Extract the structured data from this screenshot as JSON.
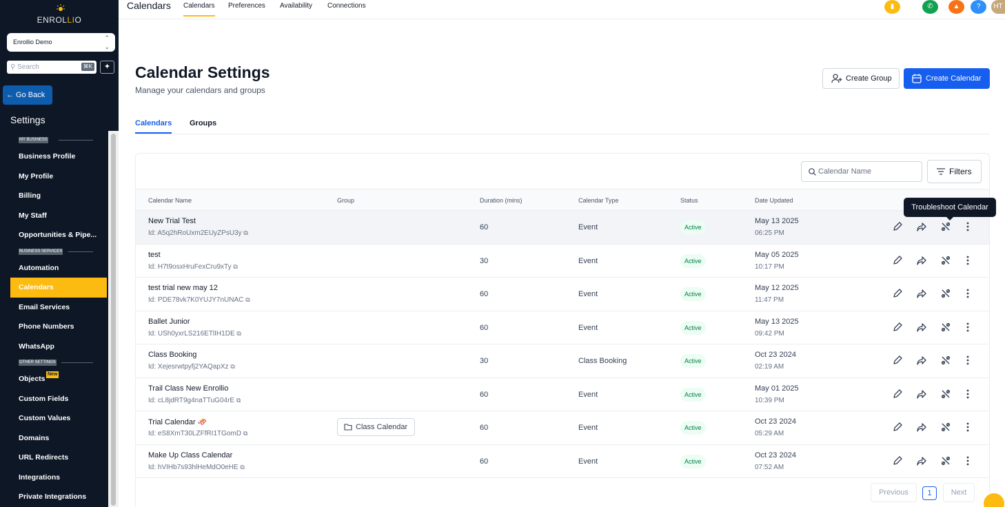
{
  "logo": {
    "text_a": "ENROL",
    "text_b": "LI",
    "text_c": "O"
  },
  "account": {
    "name": "Enrollio Demo"
  },
  "search": {
    "placeholder": "Search",
    "shortcut": "⌘K"
  },
  "sidebar": {
    "go_back": "← Go Back",
    "title": "Settings",
    "sections": [
      {
        "label": "MY BUSINESS",
        "items": [
          {
            "label": "Business Profile"
          },
          {
            "label": "My Profile"
          },
          {
            "label": "Billing"
          },
          {
            "label": "My Staff"
          },
          {
            "label": "Opportunities & Pipe..."
          }
        ]
      },
      {
        "label": "BUSINESS SERVICES",
        "items": [
          {
            "label": "Automation"
          },
          {
            "label": "Calendars",
            "active": true
          },
          {
            "label": "Email Services"
          },
          {
            "label": "Phone Numbers"
          },
          {
            "label": "WhatsApp"
          }
        ]
      },
      {
        "label": "OTHER SETTINGS",
        "items": [
          {
            "label": "Objects",
            "badge": "New"
          },
          {
            "label": "Custom Fields"
          },
          {
            "label": "Custom Values"
          },
          {
            "label": "Domains"
          },
          {
            "label": "URL Redirects"
          },
          {
            "label": "Integrations"
          },
          {
            "label": "Private Integrations"
          }
        ]
      }
    ]
  },
  "topbar": {
    "brand": "Calendars",
    "nav": [
      "Calendars",
      "Preferences",
      "Availability",
      "Connections"
    ],
    "avatar": "HT"
  },
  "page": {
    "title": "Calendar Settings",
    "subtitle": "Manage your calendars and groups",
    "create_group": "Create Group",
    "create_calendar": "Create Calendar",
    "tabs": [
      "Calendars",
      "Groups"
    ]
  },
  "table": {
    "search_placeholder": "Calendar Name",
    "filters_label": "Filters",
    "columns": [
      "Calendar Name",
      "Group",
      "Duration (mins)",
      "Calendar Type",
      "Status",
      "Date Updated"
    ],
    "rows": [
      {
        "name": "New Trial Test",
        "id": "Id: A5q2hRoUxm2EUyZPsU3y",
        "group": "",
        "duration": "60",
        "type": "Event",
        "status": "Active",
        "date": "May 13 2025",
        "time": "06:25 PM"
      },
      {
        "name": "test",
        "id": "Id: H7t9osxHruFexCru9xTy",
        "group": "",
        "duration": "30",
        "type": "Event",
        "status": "Active",
        "date": "May 05 2025",
        "time": "10:17 PM"
      },
      {
        "name": "test trial new may 12",
        "id": "Id: PDE78vk7K0YUJY7nUNAC",
        "group": "",
        "duration": "60",
        "type": "Event",
        "status": "Active",
        "date": "May 12 2025",
        "time": "11:47 PM"
      },
      {
        "name": "Ballet Junior",
        "id": "Id: USh0yxrLS216ETlIH1DE",
        "group": "",
        "duration": "60",
        "type": "Event",
        "status": "Active",
        "date": "May 13 2025",
        "time": "09:42 PM"
      },
      {
        "name": "Class Booking",
        "id": "Id: Xejesrwtpyfj2YAQapXz",
        "group": "",
        "duration": "30",
        "type": "Class Booking",
        "status": "Active",
        "date": "Oct 23 2024",
        "time": "02:19 AM"
      },
      {
        "name": "Trail Class New Enrollio",
        "id": "Id: cL8jdRT9g4naTTuG04rE",
        "group": "",
        "duration": "60",
        "type": "Event",
        "status": "Active",
        "date": "May 01 2025",
        "time": "10:39 PM"
      },
      {
        "name": "Trial Calendar 🛷",
        "id": "Id: eS8XmT30LZFfRI1TGomD",
        "group": "Class Calendar",
        "duration": "60",
        "type": "Event",
        "status": "Active",
        "date": "Oct 23 2024",
        "time": "05:29 AM"
      },
      {
        "name": "Make Up Class Calendar",
        "id": "Id: hVIHb7s93hlHeMdO0eHE",
        "group": "",
        "duration": "60",
        "type": "Event",
        "status": "Active",
        "date": "Oct 23 2024",
        "time": "07:52 AM"
      }
    ],
    "tooltip": "Troubleshoot Calendar",
    "pagination": {
      "prev": "Previous",
      "page": "1",
      "next": "Next"
    }
  },
  "colors": {
    "accent": "#155eef",
    "sidebar_active": "#fdbb12",
    "sidebar_bg": "#0e1726",
    "status_green": "#027a48"
  }
}
